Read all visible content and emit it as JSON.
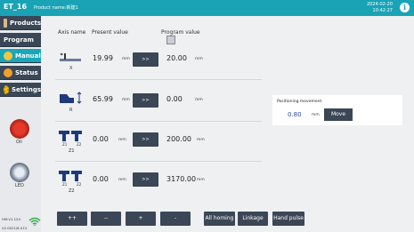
{
  "header": {
    "app_name": "ET_16",
    "product_name": "Product name:新建1",
    "date": "2024-02-20",
    "time": "10:42:27",
    "info_glyph": "i"
  },
  "sidebar": {
    "items": [
      {
        "label": "Products",
        "icon": "products-icon"
      },
      {
        "label": "Program",
        "icon": "program-icon"
      },
      {
        "label": "Manual",
        "icon": "manual-icon",
        "active": true
      },
      {
        "label": "Status",
        "icon": "status-icon"
      },
      {
        "label": "Settings",
        "icon": "settings-icon"
      }
    ],
    "oil_label": "Oil",
    "led_label": "LED",
    "version1": "HM:V1.124",
    "version2": "V2.0021/6.474"
  },
  "columns": {
    "axis": "Axis name",
    "present": "Present value",
    "program": "Program value"
  },
  "axes": [
    {
      "name": "X",
      "present": "19.99",
      "present_unit": "mm",
      "button": ">>",
      "program": "20.00",
      "program_unit": "mm"
    },
    {
      "name": "R",
      "present": "65.99",
      "present_unit": "mm",
      "button": ">>",
      "program": "0.00",
      "program_unit": "mm"
    },
    {
      "name": "Z1",
      "sub1": "Z1",
      "sub2": "Z2",
      "present": "0.00",
      "present_unit": "mm",
      "button": ">>",
      "program": "200.00",
      "program_unit": "mm"
    },
    {
      "name": "Z2",
      "sub1": "Z1",
      "sub2": "Z2",
      "present": "0.00",
      "present_unit": "mm",
      "button": ">>",
      "program": "3170.00",
      "program_unit": "mm"
    }
  ],
  "positioning": {
    "label": "Positioning movement",
    "value": "0.80",
    "unit": "mm",
    "move_label": "Move"
  },
  "bottom": {
    "fast_plus": "++",
    "fast_minus": "--",
    "plus": "+",
    "minus": "-",
    "all_homing": "All homing",
    "linkage": "Linkage",
    "hand_pulse": "Hand pulse"
  },
  "colors": {
    "accent": "#1aa3b5",
    "button": "#3b4756",
    "sidebar_item": "#3a4757"
  }
}
